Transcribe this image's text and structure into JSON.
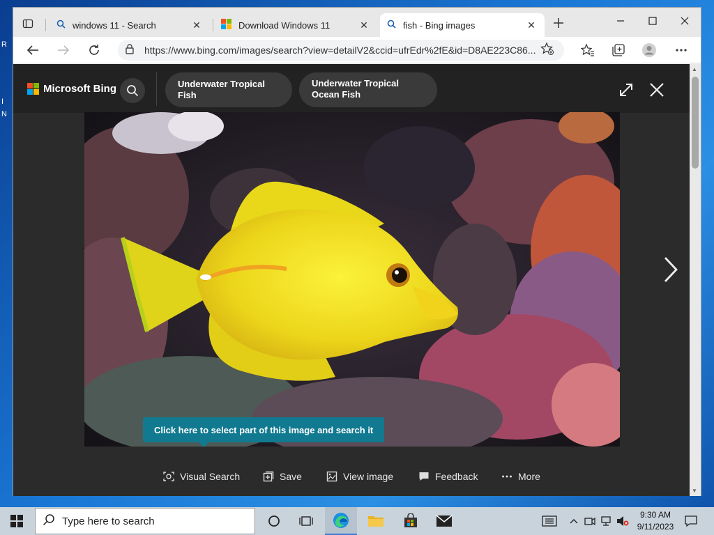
{
  "desktop": {
    "fragment_r": "R",
    "fragment_i": "I",
    "fragment_n": "N"
  },
  "browser": {
    "tabs": [
      {
        "title": "windows 11 - Search"
      },
      {
        "title": "Download Windows 11"
      },
      {
        "title": "fish - Bing images"
      }
    ],
    "close_glyph": "✕",
    "url": "https://www.bing.com/images/search?view=detailV2&ccid=ufrEdr%2fE&id=D8AE223C86..."
  },
  "bing": {
    "logo_text": "Microsoft Bing",
    "chips": [
      {
        "label": "Underwater Tropical Fish"
      },
      {
        "label": "Underwater Tropical Ocean Fish"
      }
    ],
    "visual_search_tip": "Click here to select part of this image and search it",
    "actions": [
      {
        "label": "Visual Search"
      },
      {
        "label": "Save"
      },
      {
        "label": "View image"
      },
      {
        "label": "Feedback"
      },
      {
        "label": "More"
      }
    ]
  },
  "taskbar": {
    "search_placeholder": "Type here to search",
    "time": "9:30 AM",
    "date": "9/11/2023"
  },
  "colors": {
    "fish": "#f2e21e",
    "tip": "#117a90",
    "ms_red": "#f25022",
    "ms_green": "#7fba00",
    "ms_blue": "#00a4ef",
    "ms_yellow": "#ffb900"
  }
}
